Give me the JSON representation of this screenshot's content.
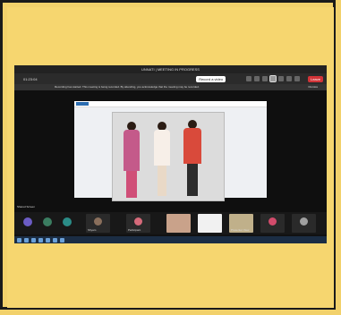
{
  "window": {
    "title": "UNNATI | MEETING IN PROGRESS"
  },
  "toolbar": {
    "time": "01:23:04",
    "record_label": "Record a video",
    "leave_label": "Leave"
  },
  "notice": {
    "text": "Recording has started. This meeting is being recorded. By attending, you acknowledge that the meeting may be recorded.",
    "dismiss": "Dismiss"
  },
  "presenter": {
    "label": "Shared Screen"
  },
  "participants": [
    {
      "label": "Shyam"
    },
    {
      "label": "Participant"
    },
    {
      "label": "Presenter View"
    }
  ],
  "colors": {
    "page_bg": "#f6d66f",
    "leave": "#d13438"
  }
}
